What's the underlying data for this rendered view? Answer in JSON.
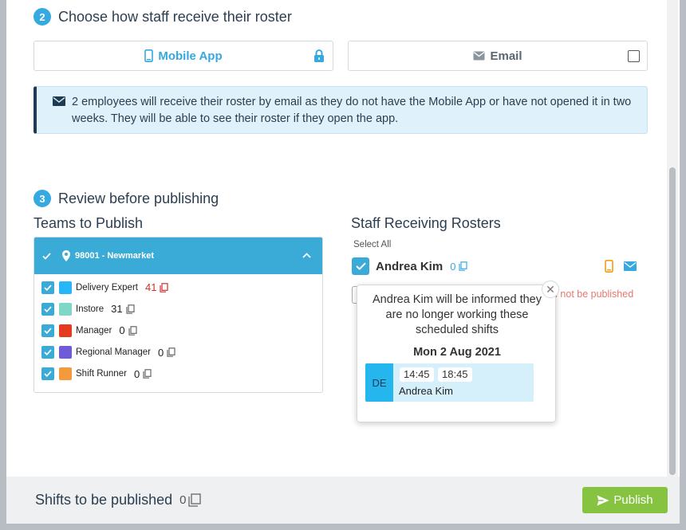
{
  "step2": {
    "number": "2",
    "title": "Choose how staff receive their roster"
  },
  "delivery": {
    "mobile_label": "Mobile App",
    "email_label": "Email"
  },
  "info_message": "2 employees will receive their roster by email as they do not have the Mobile App or have not opened it in two weeks. They will be able to see their roster if they open the app.",
  "step3": {
    "number": "3",
    "title": "Review before publishing"
  },
  "teams": {
    "heading": "Teams to Publish",
    "location": "98001 - Newmarket",
    "items": [
      {
        "name": "Delivery Expert",
        "count": "41",
        "color": "#29b6f6",
        "highlight": true
      },
      {
        "name": "Instore",
        "count": "31",
        "color": "#7fd8c7",
        "highlight": false
      },
      {
        "name": "Manager",
        "count": "0",
        "color": "#e53a1e",
        "highlight": false
      },
      {
        "name": "Regional Manager",
        "count": "0",
        "color": "#6f5bd6",
        "highlight": false
      },
      {
        "name": "Shift Runner",
        "count": "0",
        "color": "#f59a3c",
        "highlight": false
      }
    ]
  },
  "staff": {
    "heading": "Staff Receiving Rosters",
    "select_all": "Select All",
    "name": "Andrea Kim",
    "count": "0",
    "partial_note": "d not be published"
  },
  "popover": {
    "message": "Andrea Kim will be informed they are no longer working these scheduled shifts",
    "date": "Mon 2 Aug 2021",
    "shift": {
      "initials": "DE",
      "start": "14:45",
      "end": "18:45",
      "employee": "Andrea Kim"
    }
  },
  "footer": {
    "label": "Shifts to be published",
    "count": "0",
    "publish_label": "Publish"
  },
  "colors": {
    "accent": "#36a9e1",
    "publish": "#86c341",
    "alert": "#d0312d"
  }
}
